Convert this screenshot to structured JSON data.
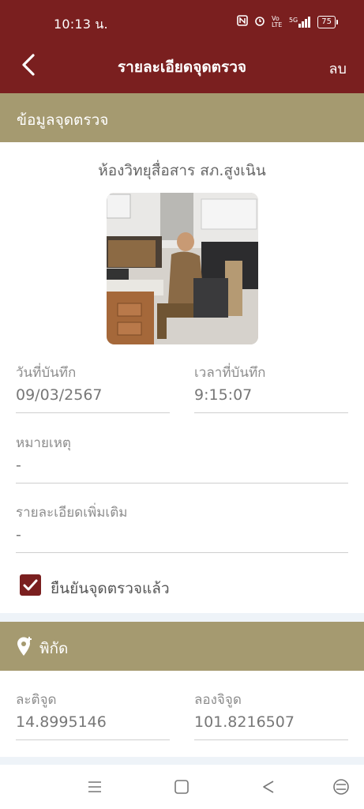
{
  "status_bar": {
    "time": "10:13 น.",
    "icons": [
      "nfc-icon",
      "alarm-icon",
      "volte-icon",
      "signal-5g-icon"
    ],
    "volte_text": "Vo LTE",
    "network_text": "5G",
    "battery": "75"
  },
  "app_bar": {
    "title": "รายละเอียดจุดตรวจ",
    "delete_label": "ลบ"
  },
  "section_info": {
    "title": "ข้อมูลจุดตรวจ",
    "location_name": "ห้องวิทยุสื่อสาร สภ.สูงเนิน",
    "record_date_label": "วันที่บันทึก",
    "record_date": "09/03/2567",
    "record_time_label": "เวลาที่บันทึก",
    "record_time": "9:15:07",
    "note_label": "หมายเหตุ",
    "note_value": "-",
    "details_label": "รายละเอียดเพิ่มเติม",
    "details_value": "-",
    "confirm_label": "ยืนยันจุดตรวจแล้ว",
    "confirmed": true
  },
  "section_coords": {
    "title": "พิกัด",
    "lat_label": "ละติจูด",
    "lat_value": "14.8995146",
    "lng_label": "ลองจิจูด",
    "lng_value": "101.8216507"
  },
  "colors": {
    "primary": "#7a1f1f",
    "section_header": "#a59a70"
  },
  "nav_bar": {
    "icons": [
      "menu-icon",
      "home-icon",
      "back-triangle-icon",
      "accessibility-icon"
    ]
  }
}
